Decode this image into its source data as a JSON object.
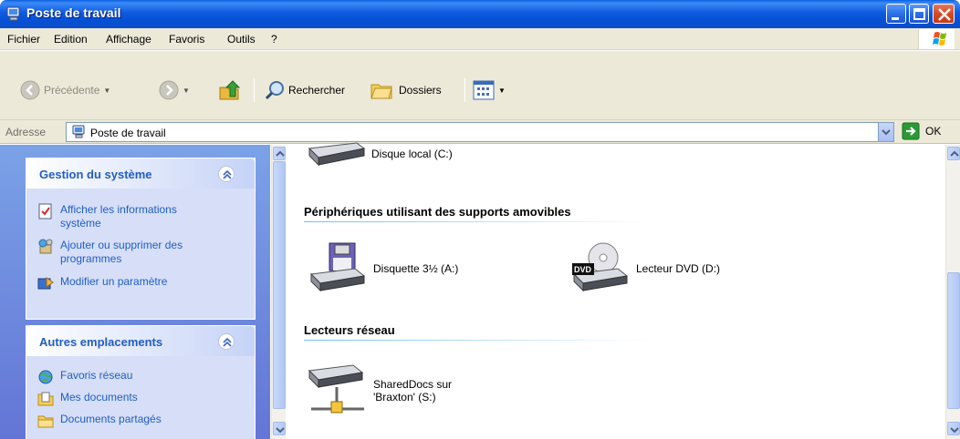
{
  "window": {
    "title": "Poste de travail"
  },
  "menu": {
    "items": [
      "Fichier",
      "Edition",
      "Affichage",
      "Favoris",
      "Outils",
      "?"
    ]
  },
  "toolbar": {
    "back_label": "Précédente",
    "search_label": "Rechercher",
    "folders_label": "Dossiers"
  },
  "address": {
    "label": "Adresse",
    "value": "Poste de travail",
    "go_label": "OK"
  },
  "left_pane": {
    "system_tasks": {
      "title": "Gestion du système",
      "items": [
        {
          "label_line1": "Afficher les informations",
          "label_line2": "système"
        },
        {
          "label_line1": "Ajouter ou supprimer des",
          "label_line2": "programmes"
        },
        {
          "label_line1": "Modifier un paramètre",
          "label_line2": ""
        }
      ]
    },
    "other_places": {
      "title": "Autres emplacements",
      "items": [
        "Favoris réseau",
        "Mes documents",
        "Documents partagés"
      ]
    }
  },
  "main": {
    "local_disk": "Disque local (C:)",
    "removable": {
      "title": "Périphériques utilisant des supports amovibles",
      "floppy": "Disquette 3½ (A:)",
      "dvd": "Lecteur DVD (D:)",
      "dvd_badge": "DVD"
    },
    "network": {
      "title": "Lecteurs réseau",
      "share_line1": "SharedDocs sur",
      "share_line2": "'Braxton' (S:)"
    }
  },
  "colors": {
    "titlebar": "#0651d6",
    "task_text": "#215dc6",
    "left_pane_bg": "#7ba2e7"
  }
}
